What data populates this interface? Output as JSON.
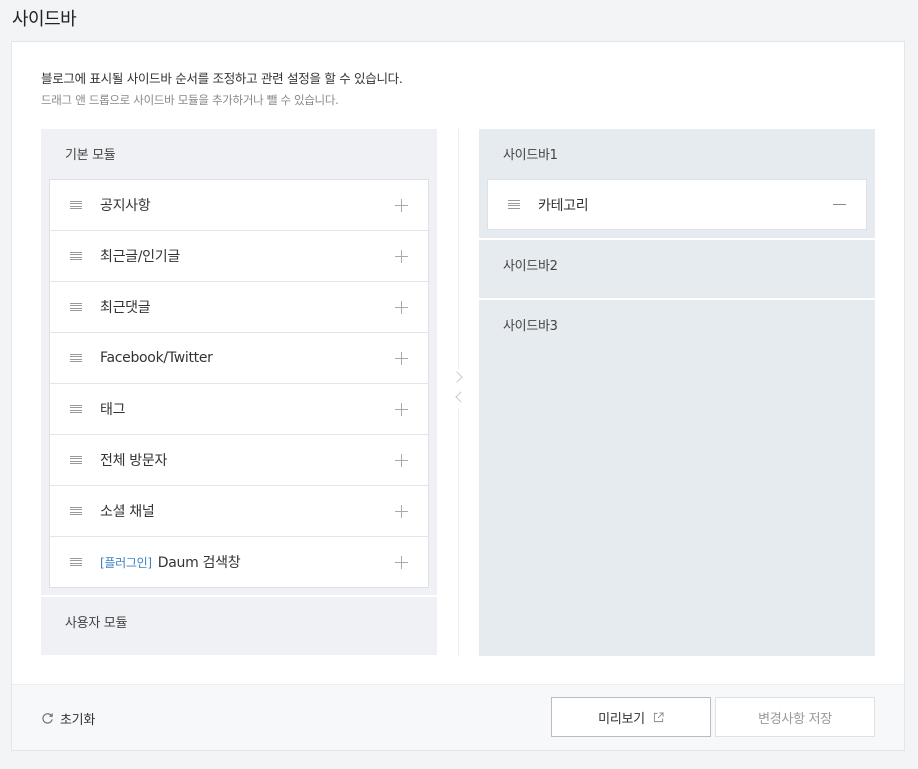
{
  "page": {
    "title": "사이드바"
  },
  "description": {
    "main": "블로그에 표시될 사이드바 순서를 조정하고 관련 설정을 할 수 있습니다.",
    "sub": "드래그 앤 드롭으로 사이드바 모듈을 추가하거나 뺄 수 있습니다."
  },
  "basic_modules": {
    "title": "기본 모듈",
    "items": [
      {
        "label": "공지사항"
      },
      {
        "label": "최근글/인기글"
      },
      {
        "label": "최근댓글"
      },
      {
        "label": "Facebook/Twitter"
      },
      {
        "label": "태그"
      },
      {
        "label": "전체 방문자"
      },
      {
        "label": "소셜 채널"
      },
      {
        "tag": "[플러그인]",
        "label": "Daum 검색창"
      }
    ]
  },
  "user_modules": {
    "title": "사용자 모듈"
  },
  "sidebars": [
    {
      "title": "사이드바1",
      "items": [
        {
          "label": "카테고리"
        }
      ]
    },
    {
      "title": "사이드바2",
      "items": []
    },
    {
      "title": "사이드바3",
      "items": []
    }
  ],
  "footer": {
    "reset_label": "초기화",
    "preview_label": "미리보기",
    "save_label": "변경사항 저장"
  }
}
